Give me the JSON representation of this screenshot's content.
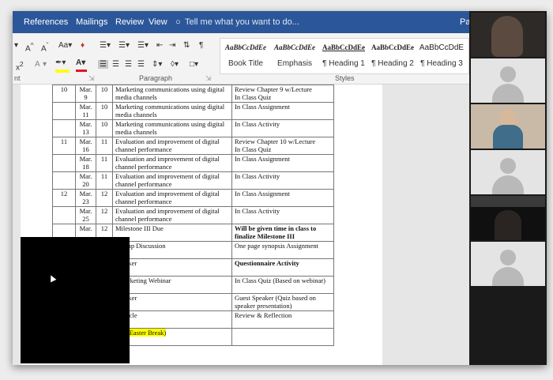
{
  "menu": {
    "tabs": [
      "References",
      "Mailings",
      "Review",
      "View"
    ],
    "tell_me": "Tell me what you want to do...",
    "user_initials": "Pa"
  },
  "ribbon": {
    "paragraph_label": "Paragraph",
    "styles_label": "Styles",
    "font_label": "nt",
    "styles": [
      {
        "preview": "AaBbCcDdEe",
        "name": "Book Title"
      },
      {
        "preview": "AaBbCcDdEe",
        "name": "Emphasis"
      },
      {
        "preview": "AaBbCcDdEe",
        "name": "¶ Heading 1"
      },
      {
        "preview": "AaBbCcDdEe",
        "name": "¶ Heading 2"
      },
      {
        "preview": "AaBbCcDdE",
        "name": "¶ Heading 3"
      }
    ]
  },
  "schedule": {
    "rows": [
      {
        "week": "10",
        "date": "Mar. 9",
        "chapter": "10",
        "topic": "Marketing communications using digital media channels",
        "assignment": "Review Chapter 9 w/Lecture\nIn Class Quiz"
      },
      {
        "week": "",
        "date": "Mar. 11",
        "chapter": "10",
        "topic": "Marketing communications using digital media channels",
        "assignment": "In Class Assignment"
      },
      {
        "week": "",
        "date": "Mar. 13",
        "chapter": "10",
        "topic": "Marketing communications using digital media channels",
        "assignment": "In Class Activity"
      },
      {
        "week": "11",
        "date": "Mar. 16",
        "chapter": "11",
        "topic": "Evaluation and improvement of digital channel performance",
        "assignment": "Review Chapter 10 w/Lecture\nIn Class Quiz"
      },
      {
        "week": "",
        "date": "Mar. 18",
        "chapter": "11",
        "topic": "Evaluation and improvement of digital channel performance",
        "assignment": "In Class Assignment"
      },
      {
        "week": "",
        "date": "Mar. 20",
        "chapter": "11",
        "topic": "Evaluation and improvement of digital channel performance",
        "assignment": "In Class Activity"
      },
      {
        "week": "12",
        "date": "Mar. 23",
        "chapter": "12",
        "topic": "Evaluation and improvement of digital channel performance",
        "assignment": "In Class Assignment"
      },
      {
        "week": "",
        "date": "Mar. 25",
        "chapter": "12",
        "topic": "Evaluation and improvement of digital channel performance",
        "assignment": "In Class Activity"
      },
      {
        "week": "",
        "date": "Mar.",
        "chapter": "12",
        "topic": "Milestone III Due",
        "assignment": "Will be given time in class to finalize Milestone III",
        "bold": true
      },
      {
        "week": "",
        "date": "",
        "chapter": "",
        "topic": "/Group Discussion",
        "assignment": "One page synopsis Assignment"
      },
      {
        "week": "",
        "date": "",
        "chapter": "",
        "topic": "Speaker",
        "assignment": "Questionnaire Activity",
        "bold": true
      },
      {
        "week": "",
        "date": "",
        "chapter": "",
        "topic": "l Marketing Webinar",
        "assignment": "In Class Quiz  (Based on webinar)"
      },
      {
        "week": "",
        "date": "",
        "chapter": "",
        "topic": "Speaker",
        "assignment": "Guest Speaker (Quiz based on speaker presentation)"
      },
      {
        "week": "",
        "date": "",
        "chapter": "",
        "topic": "l Article",
        "assignment": "Review & Reflection"
      },
      {
        "week": "",
        "date": "",
        "chapter": "",
        "topic": "lass (Easter Break)",
        "assignment": "",
        "highlight": true
      }
    ]
  },
  "colors": {
    "title_bar": "#2b579a",
    "highlight": "#ffff00",
    "font_color_bar": "#e81123"
  },
  "participants_count": 6
}
